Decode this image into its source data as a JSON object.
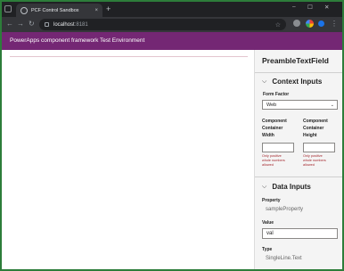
{
  "browser": {
    "tab_title": "PCF Control Sandbox",
    "tab_close": "×",
    "new_tab": "+",
    "window_controls": {
      "minimize": "–",
      "maximize": "☐",
      "close": "✕"
    },
    "nav": {
      "back": "←",
      "forward": "→",
      "reload": "↻",
      "menu": "⋮"
    },
    "url_host": "localhost",
    "url_port": ":8181",
    "bookmark": "☆"
  },
  "app": {
    "header_title": "PowerApps component framework Test Environment"
  },
  "panel": {
    "control_name": "PreambleTextField",
    "context_inputs": {
      "header": "Context Inputs",
      "form_factor_label": "Form Factor",
      "form_factor_value": "Web",
      "width_label_1": "Component",
      "width_label_2": "Container",
      "width_label_3": "Width",
      "height_label_1": "Component",
      "height_label_2": "Container",
      "height_label_3": "Height",
      "error_1": "Only positive",
      "error_2": "whole numbers",
      "error_3": "allowed"
    },
    "data_inputs": {
      "header": "Data Inputs",
      "property_label": "Property",
      "property_value": "sampleProperty",
      "value_label": "Value",
      "value_input": "val",
      "type_label": "Type",
      "type_value": "SingleLine.Text"
    }
  },
  "icons": {
    "chevron": "⌵",
    "select_arrow": "⌄"
  },
  "colors": {
    "app_header": "#742774",
    "error": "#a4262c",
    "browser_frame": "#202124"
  }
}
